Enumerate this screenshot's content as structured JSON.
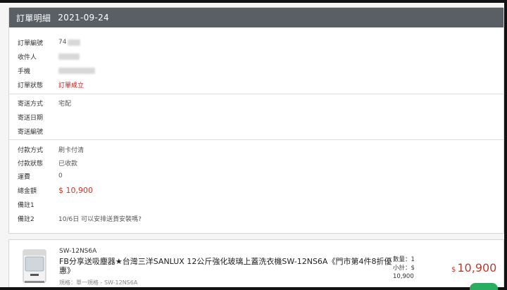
{
  "header": {
    "title": "訂單明細",
    "date": "2021-09-24"
  },
  "order": {
    "number_label": "訂單編號",
    "number_value": "74",
    "recipient_label": "收件人",
    "phone_label": "手機",
    "status_label": "訂單狀態",
    "status_value": "訂單成立"
  },
  "shipping": {
    "method_label": "寄送方式",
    "method_value": "宅配",
    "date_label": "寄送日期",
    "tracking_label": "寄送編號"
  },
  "payment": {
    "method_label": "付款方式",
    "method_value": "刷卡付清",
    "status_label": "付款狀態",
    "status_value": "已收款",
    "shipping_fee_label": "運費",
    "shipping_fee_value": "0",
    "total_label": "總金額",
    "total_value": "$ 10,900",
    "note1_label": "備註1",
    "note2_label": "備註2",
    "note2_value": "10/6日 可以安排送貨安裝嗎?"
  },
  "product": {
    "model": "SW-12NS6A",
    "name": "FB分享送吸塵器★台灣三洋SANLUX 12公斤強化玻璃上蓋洗衣機SW-12NS6A《門市第4件8折優惠》",
    "spec": "規格：單一規格 - SW-12NS6A",
    "qty_text": "數量：1",
    "subtotal_label": "小計：$",
    "subtotal_value": "10,900",
    "price_currency": "$",
    "price_value": "10,900"
  },
  "colors": {
    "header_bg": "#5a5f66",
    "accent_red": "#c0392b",
    "green": "#27ae60"
  }
}
